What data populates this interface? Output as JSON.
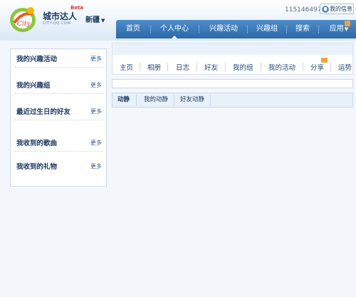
{
  "header": {
    "logo_text": "城市达人",
    "logo_beta": "Beta",
    "logo_url": "CITY.QQ.COM",
    "region": "新疆",
    "user_id": "115146497",
    "messages_label": "我的信息"
  },
  "nav": {
    "items": [
      {
        "label": "首页"
      },
      {
        "label": "个人中心",
        "active": true
      },
      {
        "label": "兴趣活动"
      },
      {
        "label": "兴趣组"
      },
      {
        "label": "搜索"
      },
      {
        "label": "应用"
      }
    ]
  },
  "sidebar": {
    "more_label": "更多",
    "items": [
      {
        "label": "我的兴趣活动"
      },
      {
        "label": "我的兴趣组"
      },
      {
        "label": "最近过生日的好友"
      },
      {
        "label": "我收到的歌曲"
      },
      {
        "label": "我收到的礼物"
      }
    ]
  },
  "tabs": [
    {
      "label": "主页"
    },
    {
      "label": "相册"
    },
    {
      "label": "日志"
    },
    {
      "label": "好友"
    },
    {
      "label": "我的组"
    },
    {
      "label": "我的活动"
    },
    {
      "label": "分享"
    },
    {
      "label": "运势"
    }
  ],
  "subtabs": [
    {
      "label": "动静",
      "active": true
    },
    {
      "label": "我的动静"
    },
    {
      "label": "好友动静"
    }
  ],
  "colors": {
    "nav_bg": "#2c68a8",
    "link": "#2e5c97",
    "badge": "#f0a536"
  }
}
